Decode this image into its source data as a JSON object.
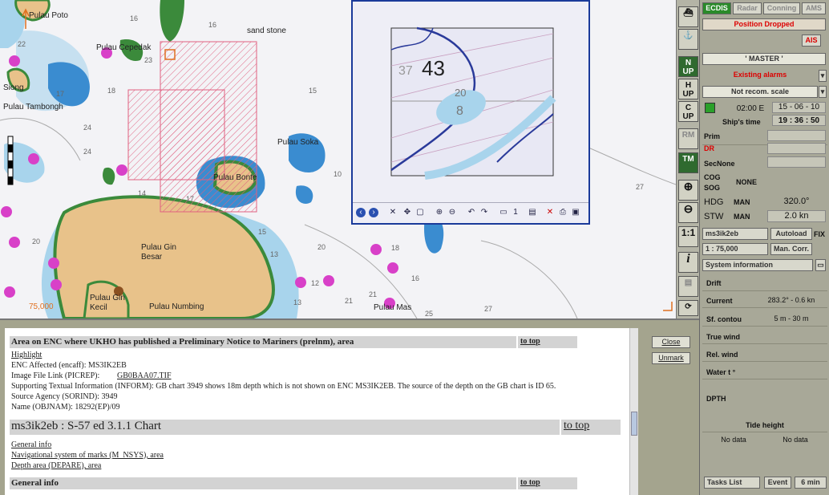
{
  "chart": {
    "places": [
      {
        "id": "poto",
        "text": "Pulau Poto"
      },
      {
        "id": "cepedak",
        "text": "Pulau Cepedak"
      },
      {
        "id": "sandstone",
        "text": "sand stone"
      },
      {
        "id": "siong",
        "text": "Siong"
      },
      {
        "id": "tambongh",
        "text": "Pulau Tambongh"
      },
      {
        "id": "soka",
        "text": "Pulau Soka"
      },
      {
        "id": "bonte",
        "text": "Pulau Bonte"
      },
      {
        "id": "gin_besar",
        "text": "Pulau Gin Besar"
      },
      {
        "id": "gin_kecil",
        "text": "Pulau Gin Kecil"
      },
      {
        "id": "numbing",
        "text": "Pulau Numbing"
      },
      {
        "id": "mas",
        "text": "Pulau Mas"
      },
      {
        "id": "scale",
        "text": "75,000"
      }
    ],
    "depths": [
      "16",
      "23",
      "17",
      "18",
      "24",
      "14",
      "15",
      "27",
      "10",
      "20",
      "16",
      "18",
      "21",
      "13",
      "12",
      "25",
      "20",
      "24",
      "22",
      "16",
      "13",
      "17",
      "15",
      "27",
      "21"
    ]
  },
  "popup": {
    "depth_main": "43",
    "depth_faint": "37",
    "depth_small": "20",
    "depth_small2": "8",
    "page_indicator": "1"
  },
  "toolbar": {
    "north_up": "N UP",
    "head_up": "H UP",
    "course_up": "C UP",
    "rm": "RM",
    "tm": "TM",
    "one_to_one": "1:1",
    "info": "i"
  },
  "panel": {
    "tabs": [
      "ECDIS",
      "Radar",
      "Conning",
      "AMS"
    ],
    "position_dropped": "Position Dropped",
    "ais": "AIS",
    "master": "' MASTER '",
    "existing_alarms": "Existing alarms",
    "not_recom_scale": "Not recom. scale",
    "time_offset": "02:00 E",
    "date": "15 - 06 - 10",
    "ships_time_label": "Ship's time",
    "ships_time": "19 : 36 : 50",
    "prim": "Prim",
    "dr": "DR",
    "sec": "SecNone",
    "cog": "COG",
    "sog": "SOG",
    "cog_sog_val": "NONE",
    "hdg": "HDG",
    "hdg_mode": "MAN",
    "hdg_val": "320.0°",
    "stw": "STW",
    "stw_mode": "MAN",
    "stw_val": "2.0 kn",
    "chart_select": "ms3ik2eb",
    "autoload": "Autoload",
    "fix": "FIX",
    "scale_select": "1 : 75,000",
    "man_corr": "Man. Corr.",
    "system_info": "System information",
    "drift": "Drift",
    "current_label": "Current",
    "current_val": "283.2° - 0.6 kn",
    "sf_contour_label": "Sf. contou",
    "sf_contour_val": "5 m - 30 m",
    "true_wind": "True wind",
    "rel_wind": "Rel. wind",
    "water_t": "Water t °",
    "dpth": "DPTH",
    "tide_height": "Tide height",
    "no_data_1": "No data",
    "no_data_2": "No data",
    "tasks_list": "Tasks List",
    "event": "Event",
    "interval": "6 min"
  },
  "info": {
    "h1": "Area on ENC where UKHO has published a Preliminary Notice to Mariners (prelnm), area",
    "to_top": "to top",
    "highlight": "Highlight",
    "enc_affected": "ENC Affected (encaff): MS3IK2EB",
    "image_file_label": "Image File Link (PICREP):",
    "image_file_val": "GB0BAA07.TIF",
    "inform": "Supporting Textual Information (INFORM): GB chart 3949 shows 18m depth which is not shown on ENC MS3IK2EB. The source of the depth on the GB chart is ID 65.",
    "sorind": "Source Agency (SORIND): 3949",
    "objnam": "Name (OBJNAM): 18292(EP)/09",
    "h2": "ms3ik2eb : S-57 ed 3.1.1 Chart",
    "general_info_link": "General info",
    "nav_system": "Navigational system of marks (M_NSYS), area",
    "depth_area": "Depth area (DEPARE), area",
    "h3": "General info",
    "close": "Close",
    "unmark": "Unmark"
  }
}
